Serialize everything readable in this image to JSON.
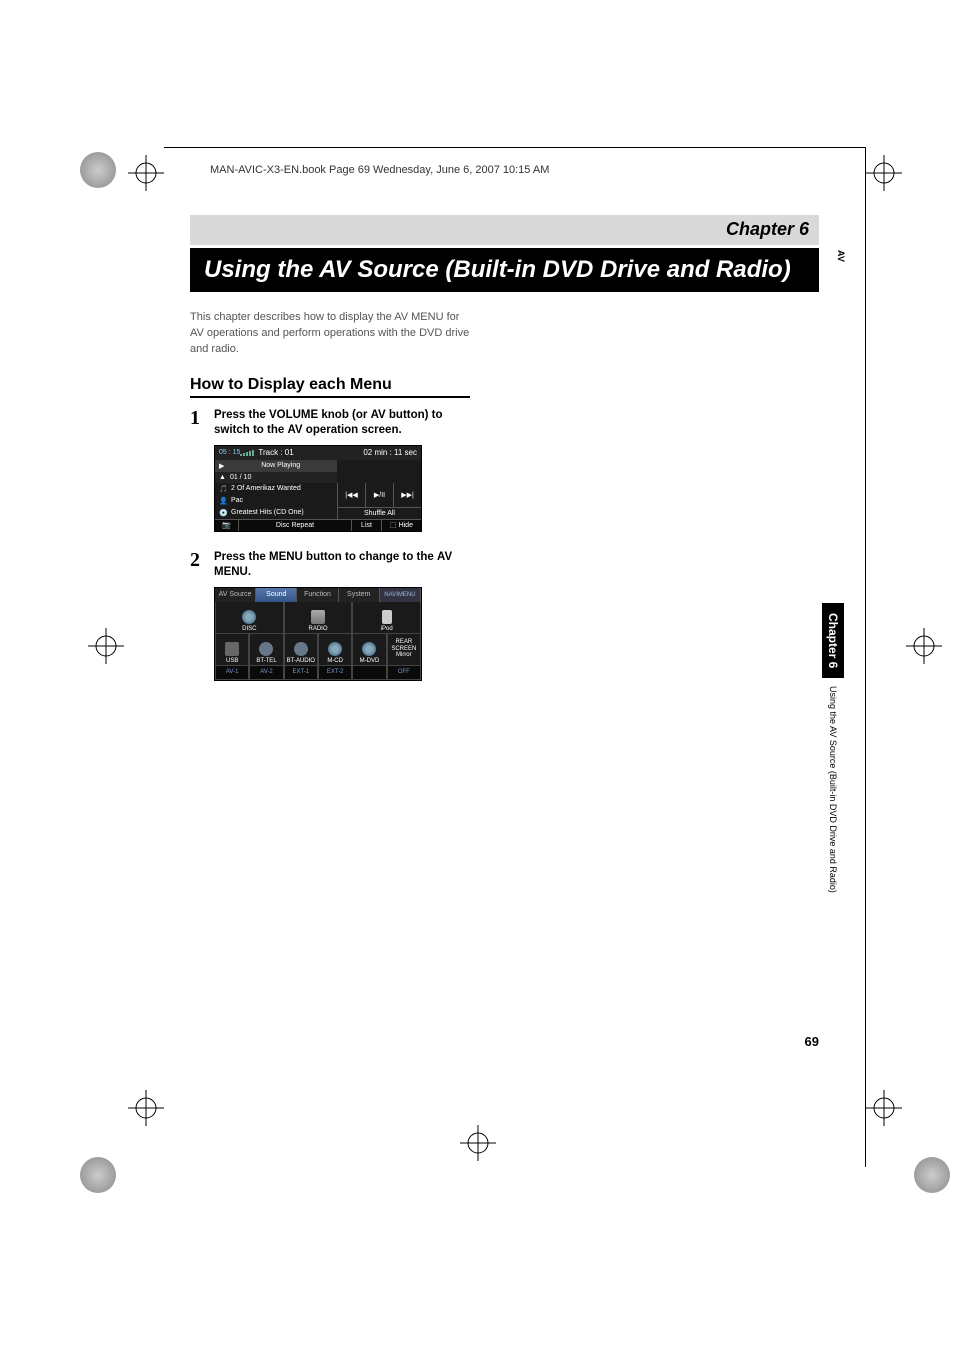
{
  "meta": {
    "header_text": "MAN-AVIC-X3-EN.book  Page 69  Wednesday, June 6, 2007  10:15 AM"
  },
  "chapter_label": "Chapter 6",
  "title": "Using the AV Source (Built-in DVD Drive and Radio)",
  "intro": "This chapter describes how to display the AV MENU for AV operations and perform operations with the DVD drive and radio.",
  "section_heading": "How to Display each Menu",
  "steps": [
    {
      "num": "1",
      "text_pre": "Press the ",
      "bold1": "VOLUME",
      "mid": " knob (or ",
      "bold2": "AV",
      "text_post": " button) to switch to the ",
      "bold3": "AV",
      "tail": " operation screen."
    },
    {
      "num": "2",
      "text_pre": "Press the ",
      "bold1": "MENU",
      "mid": " button to change to the ",
      "bold2": "AV MENU",
      "text_post": ".",
      "bold3": "",
      "tail": ""
    }
  ],
  "screenshot1": {
    "clock": "05 : 15",
    "track_label": "Track : 01",
    "time": "02 min : 11 sec",
    "now_playing": "Now Playing",
    "counter": "01 / 10",
    "song": "2 Of Amerikaz Wanted",
    "artist": "Pac",
    "album": "Greatest Hits (CD One)",
    "prev": "|◀◀",
    "play": "▶/II",
    "next": "▶▶|",
    "shuffle": "Shuffle All",
    "camera": "📷",
    "repeat": "Disc Repeat",
    "list": "List",
    "hide": "⬚ Hide"
  },
  "screenshot2": {
    "tabs": [
      "AV Source",
      "Sound",
      "Function",
      "System"
    ],
    "navi_menu_l1": "NAVI",
    "navi_menu_l2": "MENU",
    "row1": [
      "DISC",
      "RADIO",
      "iPod"
    ],
    "row2": [
      "USB",
      "BT-TEL",
      "BT-AUDIO",
      "M-CD",
      "M-DVD"
    ],
    "rear_l1": "REAR",
    "rear_l2": "SCREEN",
    "rear_l3": "Mirror",
    "row3": [
      "AV-1",
      "AV-2",
      "EXT-1",
      "EXT-2",
      "",
      "OFF"
    ]
  },
  "side": {
    "av": "AV",
    "chapter": "Chapter 6",
    "caption": "Using the AV Source (Built-in DVD Drive and Radio)"
  },
  "page_num": "69"
}
